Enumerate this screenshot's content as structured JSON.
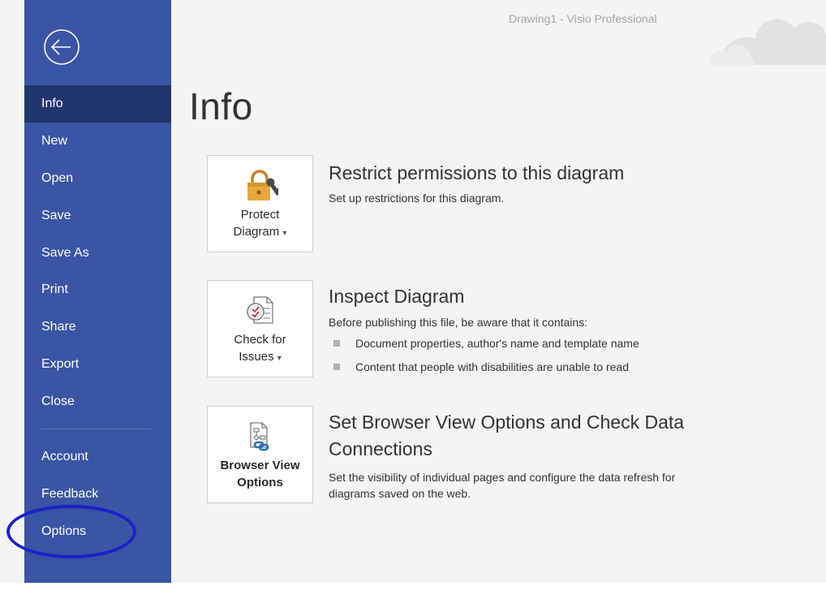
{
  "window": {
    "title": "Drawing1  -  Visio Professional"
  },
  "sidebar": {
    "items": [
      {
        "label": "Info",
        "active": true
      },
      {
        "label": "New"
      },
      {
        "label": "Open"
      },
      {
        "label": "Save"
      },
      {
        "label": "Save As"
      },
      {
        "label": "Print"
      },
      {
        "label": "Share"
      },
      {
        "label": "Export"
      },
      {
        "label": "Close"
      },
      {
        "label": "Account"
      },
      {
        "label": "Feedback"
      },
      {
        "label": "Options"
      }
    ]
  },
  "main": {
    "title": "Info",
    "sections": [
      {
        "tile": {
          "line1": "Protect",
          "line2": "Diagram",
          "icon": "lock-key-icon",
          "dropdown": true
        },
        "title": "Restrict permissions to this diagram",
        "description": "Set up restrictions for this diagram."
      },
      {
        "tile": {
          "line1": "Check for",
          "line2": "Issues",
          "icon": "inspect-document-icon",
          "dropdown": true
        },
        "title": "Inspect Diagram",
        "description": "Before publishing this file, be aware that it contains:",
        "bullets": [
          "Document properties, author's name and template name",
          "Content that people with disabilities are unable to read"
        ]
      },
      {
        "tile": {
          "line1": "Browser View",
          "line2": "Options",
          "icon": "browser-view-options-icon",
          "dropdown": false
        },
        "title_line1": "Set Browser View Options and Check Data",
        "title_line2": "Connections",
        "description_line1": "Set the visibility of individual pages and configure the data refresh for",
        "description_line2": "diagrams saved on the web."
      }
    ]
  },
  "colors": {
    "sidebar": "#3955a3",
    "sidebar_active": "#21366d",
    "annotation_circle": "#1a22c9"
  }
}
